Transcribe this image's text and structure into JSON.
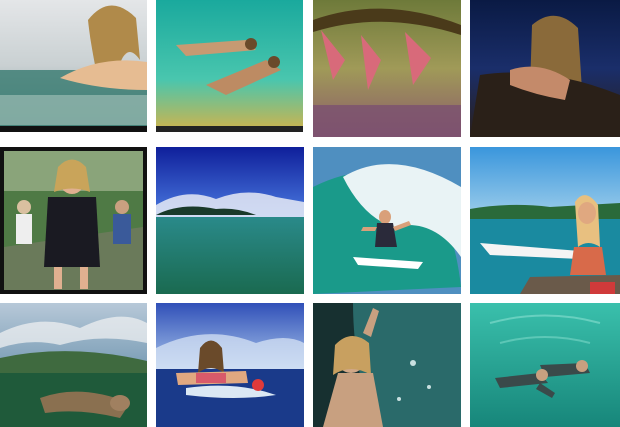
{
  "gallery": {
    "photos": [
      {
        "subject": "girl-in-water-closeup",
        "palette": [
          "#d9dde0",
          "#8fa9ad",
          "#2f6f6a",
          "#e9c39a"
        ]
      },
      {
        "subject": "underwater-swimmers",
        "palette": [
          "#1fb3a7",
          "#4fd0b8",
          "#9ccf6f",
          "#d8b04a"
        ]
      },
      {
        "subject": "hanging-from-tree",
        "palette": [
          "#7a6a3a",
          "#a5a15a",
          "#d66a7a",
          "#6e4a6a"
        ]
      },
      {
        "subject": "girl-on-rocks-at-night",
        "palette": [
          "#0d1d4a",
          "#1b2f6a",
          "#3a2a2a",
          "#d39a7a"
        ]
      },
      {
        "subject": "girl-in-black-dress-crowd",
        "palette": [
          "#2d5a2a",
          "#6a8a5a",
          "#1a1a20",
          "#e0b090"
        ]
      },
      {
        "subject": "ocean-horizon-island",
        "palette": [
          "#1c2fa0",
          "#4a6ad0",
          "#2a8a8a",
          "#1a6a5a"
        ]
      },
      {
        "subject": "surfer-on-wave",
        "palette": [
          "#5a90c0",
          "#e8f2f4",
          "#1a9a8a",
          "#ffffff"
        ]
      },
      {
        "subject": "girl-sitting-with-surfboard",
        "palette": [
          "#4aa0d8",
          "#1a8aa0",
          "#f4f4f4",
          "#c0503a"
        ]
      },
      {
        "subject": "split-water-view",
        "palette": [
          "#b0c0d0",
          "#4a7a5a",
          "#1f5a3a",
          "#2a4a2a"
        ]
      },
      {
        "subject": "girl-in-ocean-selfie",
        "palette": [
          "#3a5ac0",
          "#90b0e0",
          "#1a3a8a",
          "#e06a6a"
        ]
      },
      {
        "subject": "girl-by-tide-pool",
        "palette": [
          "#1a3a3a",
          "#2a6a6a",
          "#c8a080",
          "#3a2a2a"
        ]
      },
      {
        "subject": "underwater-turquoise",
        "palette": [
          "#2ab0a0",
          "#5ad0c0",
          "#1a8a7a",
          "#3a4a4a"
        ]
      }
    ]
  }
}
